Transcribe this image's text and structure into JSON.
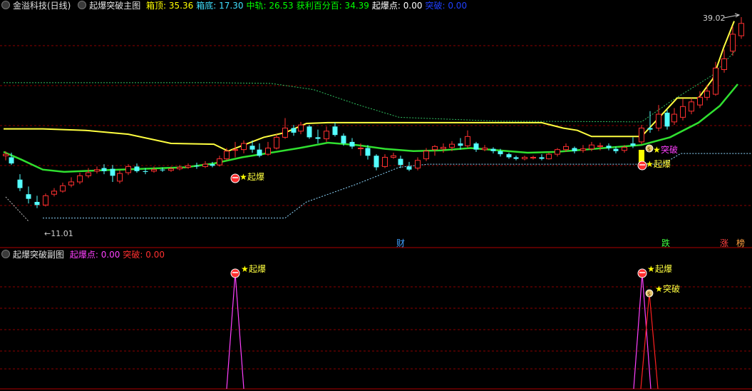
{
  "main_header": {
    "stock_title": "金溢科技(日线)",
    "indicator_name": "起爆突破主图",
    "items": [
      {
        "label": "箱顶:",
        "value": "35.36",
        "color": "#ffff00"
      },
      {
        "label": "箱底:",
        "value": "17.30",
        "color": "#40e0ff"
      },
      {
        "label": "中轨:",
        "value": "26.53",
        "color": "#00ff00"
      },
      {
        "label": "获利百分百:",
        "value": "34.39",
        "color": "#00ff00"
      },
      {
        "label": "起爆点:",
        "value": "0.00",
        "color": "#ffffff"
      },
      {
        "label": "突破:",
        "value": "0.00",
        "color": "#2040ff"
      }
    ]
  },
  "sub_header": {
    "indicator_name": "起爆突破副图",
    "items": [
      {
        "label": "起爆点:",
        "value": "0.00",
        "color": "#ff40ff"
      },
      {
        "label": "突破:",
        "value": "0.00",
        "color": "#ff3030"
      }
    ]
  },
  "annotations": {
    "high_price": "39.02",
    "low_price": "11.01",
    "signal_qibao": "起爆",
    "signal_tupo": "突破"
  },
  "markers": [
    {
      "text": "财",
      "color": "#40a0ff"
    },
    {
      "text": "跌",
      "color": "#40ff40"
    },
    {
      "text": "涨",
      "color": "#ff4040"
    },
    {
      "text": "榜",
      "color": "#ffa040"
    }
  ],
  "colors": {
    "background": "#000000",
    "grid": "#8b0000",
    "up": "#ff3030",
    "down": "#54ffff",
    "box_line": "#ffff40",
    "middle_line": "#30e030",
    "dashed_line": "#30c060",
    "signal_magenta": "#ff40ff",
    "signal_red": "#ff2020"
  },
  "icons": [
    "collapse-icon",
    "explosion-ball-icon",
    "star-icon",
    "money-bag-icon",
    "arrow-icon"
  ]
}
